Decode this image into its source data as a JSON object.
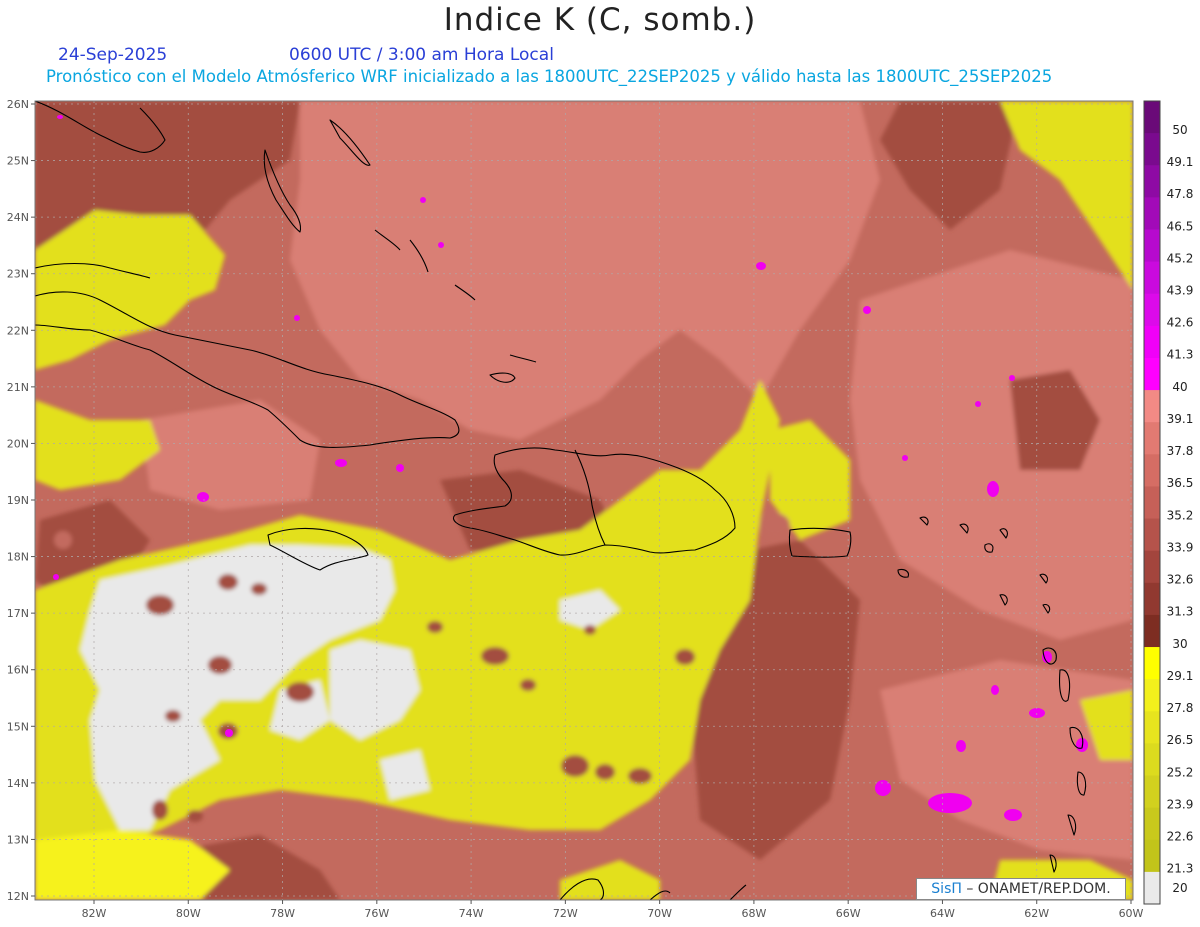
{
  "header": {
    "title": "Indice K (C, somb.)",
    "date": "24-Sep-2025",
    "valid_time": "0600 UTC / 3:00 am Hora Local",
    "subtitle": "Pronóstico con el Modelo Atmósferico WRF inicializado a las 1800UTC_22SEP2025 y válido hasta las  1800UTC_25SEP2025"
  },
  "map": {
    "lat_labels": [
      "26N",
      "25N",
      "24N",
      "23N",
      "22N",
      "21N",
      "20N",
      "19N",
      "18N",
      "17N",
      "16N",
      "15N",
      "14N",
      "13N",
      "12N"
    ],
    "lon_labels": [
      "82W",
      "80W",
      "78W",
      "76W",
      "74W",
      "72W",
      "70W",
      "68W",
      "66W",
      "64W",
      "62W",
      "60W"
    ],
    "colors": {
      "background_field": "#c36a5e",
      "dark_field": "#a34e3f",
      "pink_field": "#d97f74",
      "yellow_field": "#e3e01b",
      "bright_yellow": "#f6f21f",
      "gray_field": "#e9e9e9",
      "magenta": "#f000f0",
      "coast": "#000000",
      "grid": "#b0a8a8"
    }
  },
  "colorbar": {
    "labels": [
      "50",
      "49.1",
      "47.8",
      "46.5",
      "45.2",
      "43.9",
      "42.6",
      "41.3",
      "40",
      "39.1",
      "37.8",
      "36.5",
      "35.2",
      "33.9",
      "32.6",
      "31.3",
      "30",
      "29.1",
      "27.8",
      "26.5",
      "25.2",
      "23.9",
      "22.6",
      "21.3",
      "20"
    ],
    "colors": [
      "#6a0a78",
      "#7a0a8e",
      "#8e0aa4",
      "#a20ab8",
      "#b60ace",
      "#ca0ade",
      "#dc0aea",
      "#f000f8",
      "#ff00ff",
      "#f28a85",
      "#e27a72",
      "#d56d64",
      "#c66058",
      "#b5534b",
      "#a3453d",
      "#913930",
      "#7d2d22",
      "#ffff00",
      "#f2f01c",
      "#e7e41e",
      "#dcdb1e",
      "#d2d11e",
      "#c9c91c",
      "#c2c41a",
      "#eaeaea"
    ]
  },
  "credit": {
    "brand": "SisΠ",
    "text": " – ONAMET/REP.DOM."
  }
}
